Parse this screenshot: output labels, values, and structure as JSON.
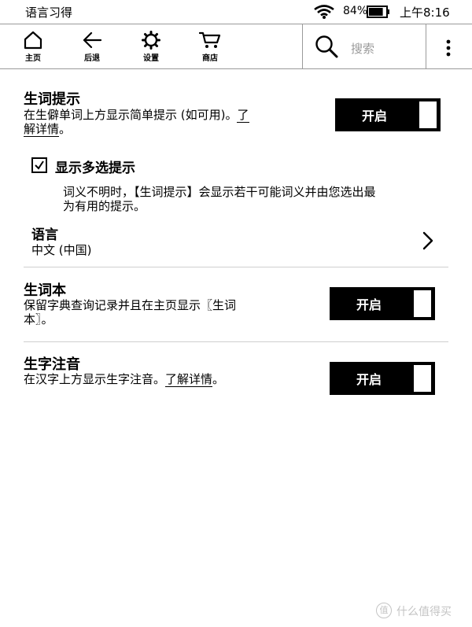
{
  "status_bar": {
    "title": "语言习得",
    "battery_percent": "84%",
    "battery_level": 0.84,
    "time": "上午8:16"
  },
  "toolbar": {
    "home_label": "主页",
    "back_label": "后退",
    "settings_label": "设置",
    "store_label": "商店",
    "search_placeholder": "搜索"
  },
  "vocab_hint": {
    "title": "生词提示",
    "desc_line1": "在生僻单词上方显示简单提示 (如可用)。",
    "desc_link_part1": "了",
    "desc_link_part2": "解详情",
    "desc_end": "。",
    "toggle_label": "开启"
  },
  "multi_hint": {
    "label": "显示多选提示",
    "checked": true,
    "desc_line1": "词义不明时，【生词提示】会显示若干可能词义并由您选出最",
    "desc_line2": "为有用的提示。"
  },
  "language": {
    "title": "语言",
    "value": "中文 (中国)"
  },
  "vocab_builder": {
    "title": "生词本",
    "desc_line1": "保留字典查询记录并且在主页显示〖生词",
    "desc_line2": "本〗。",
    "toggle_label": "开启"
  },
  "pinyin": {
    "title": "生字注音",
    "desc_text": "在汉字上方显示生字注音。",
    "desc_link": "了解详情",
    "desc_end": "。",
    "toggle_label": "开启"
  },
  "watermark": {
    "text": "什么值得买",
    "badge": "值"
  }
}
